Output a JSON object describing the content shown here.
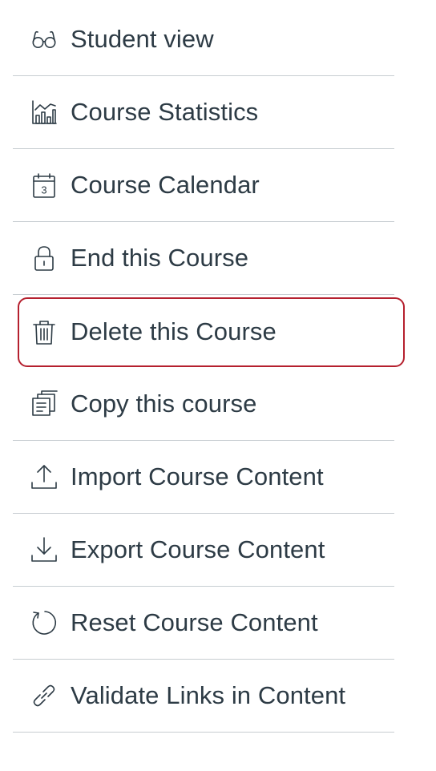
{
  "menu": {
    "items": [
      {
        "label": "Student view",
        "icon": "glasses-icon"
      },
      {
        "label": "Course Statistics",
        "icon": "statistics-chart-icon"
      },
      {
        "label": "Course Calendar",
        "icon": "calendar-icon",
        "icon_text": "3"
      },
      {
        "label": "End this Course",
        "icon": "lock-icon"
      },
      {
        "label": "Delete this Course",
        "icon": "trash-icon",
        "highlighted": true,
        "highlight_color": "#b5202e"
      },
      {
        "label": "Copy this course",
        "icon": "copy-icon"
      },
      {
        "label": "Import Course Content",
        "icon": "upload-icon"
      },
      {
        "label": "Export Course Content",
        "icon": "download-icon"
      },
      {
        "label": "Reset Course Content",
        "icon": "reset-icon"
      },
      {
        "label": "Validate Links in Content",
        "icon": "link-icon"
      }
    ]
  },
  "colors": {
    "text": "#2d3b45",
    "divider": "#c7cdd1",
    "highlight": "#b5202e"
  }
}
